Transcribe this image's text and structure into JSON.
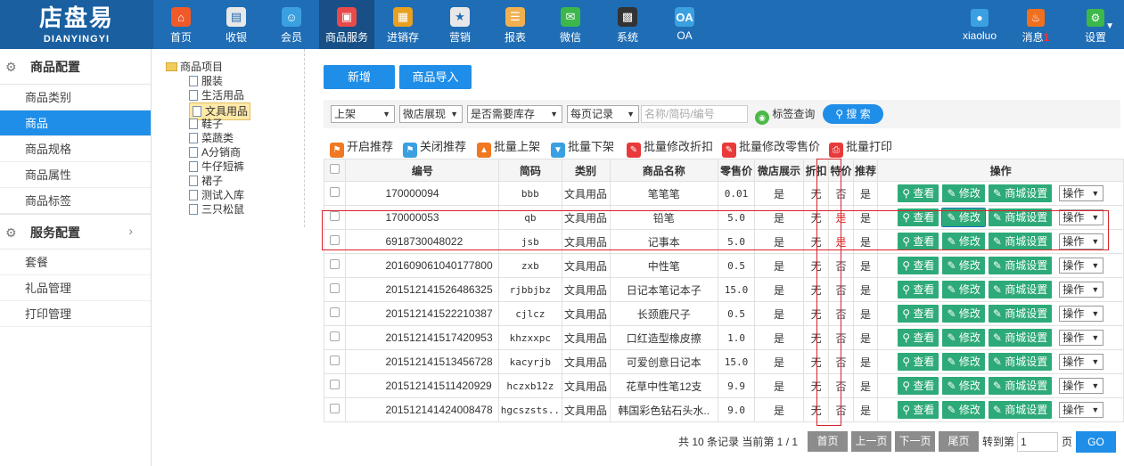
{
  "app": {
    "logo_cn": "店盘易",
    "logo_en": "DIANYINGYI"
  },
  "nav": [
    {
      "label": "首页",
      "icon": "home-icon",
      "color": "#f05a28"
    },
    {
      "label": "收银",
      "icon": "cash-register-icon",
      "color": "#e8e8e8"
    },
    {
      "label": "会员",
      "icon": "member-icon",
      "color": "#3aa0e0"
    },
    {
      "label": "商品服务",
      "icon": "goods-icon",
      "color": "#e84a4a"
    },
    {
      "label": "进销存",
      "icon": "inventory-icon",
      "color": "#e8a020"
    },
    {
      "label": "营销",
      "icon": "megaphone-icon",
      "color": "#e8e8e8"
    },
    {
      "label": "报表",
      "icon": "report-icon",
      "color": "#f0b050"
    },
    {
      "label": "微信",
      "icon": "wechat-icon",
      "color": "#3cb84a"
    },
    {
      "label": "系统",
      "icon": "monitor-icon",
      "color": "#333333"
    },
    {
      "label": "OA",
      "icon": "oa-icon",
      "color": "#3aa0e0"
    }
  ],
  "user": {
    "name": "xiaoluo",
    "messages": "消息",
    "msg_count": "1",
    "settings": "设置"
  },
  "sidebar": {
    "group1": "商品配置",
    "items1": [
      "商品类别",
      "商品",
      "商品规格",
      "商品属性",
      "商品标签"
    ],
    "group2": "服务配置",
    "items2": [
      "套餐",
      "礼品管理",
      "打印管理"
    ]
  },
  "tree": {
    "root": "商品项目",
    "children": [
      "服装",
      "生活用品",
      "文具用品",
      "鞋子",
      "菜蔬类",
      "A分销商",
      "牛仔短裤",
      "裙子",
      "测试入库",
      "三只松鼠"
    ]
  },
  "buttons": {
    "add": "新增",
    "import": "商品导入"
  },
  "filters": {
    "status": "上架",
    "wx_show": "微店展现",
    "stock": "是否需要库存",
    "page_size": "每页记录",
    "keyword_placeholder": "名称/简码/编号",
    "tag_query": "标签查询",
    "search": "搜 索"
  },
  "actions": [
    "开启推荐",
    "关闭推荐",
    "批量上架",
    "批量下架",
    "批量修改折扣",
    "批量修改零售价",
    "批量打印"
  ],
  "table": {
    "headers": [
      "编号",
      "简码",
      "类别",
      "商品名称",
      "零售价",
      "微店展示",
      "折扣",
      "特价",
      "推荐",
      "操作"
    ],
    "rows": [
      {
        "code": "170000094",
        "short": "bbb",
        "cat": "文具用品",
        "name": "笔笔笔",
        "price": "0.01",
        "wx": "是",
        "disc": "无",
        "special": "否",
        "rec": "是"
      },
      {
        "code": "170000053",
        "short": "qb",
        "cat": "文具用品",
        "name": "铅笔",
        "price": "5.0",
        "wx": "是",
        "disc": "无",
        "special": "是",
        "rec": "是"
      },
      {
        "code": "6918730048022",
        "short": "jsb",
        "cat": "文具用品",
        "name": "记事本",
        "price": "5.0",
        "wx": "是",
        "disc": "无",
        "special": "是",
        "rec": "是"
      },
      {
        "code": "201609061040177800",
        "short": "zxb",
        "cat": "文具用品",
        "name": "中性笔",
        "price": "0.5",
        "wx": "是",
        "disc": "无",
        "special": "否",
        "rec": "是"
      },
      {
        "code": "201512141526486325",
        "short": "rjbbjbz",
        "cat": "文具用品",
        "name": "日记本笔记本子",
        "price": "15.0",
        "wx": "是",
        "disc": "无",
        "special": "否",
        "rec": "是"
      },
      {
        "code": "201512141522210387",
        "short": "cjlcz",
        "cat": "文具用品",
        "name": "长颈鹿尺子",
        "price": "0.5",
        "wx": "是",
        "disc": "无",
        "special": "否",
        "rec": "是"
      },
      {
        "code": "201512141517420953",
        "short": "khzxxpc",
        "cat": "文具用品",
        "name": "口红造型橡皮擦",
        "price": "1.0",
        "wx": "是",
        "disc": "无",
        "special": "否",
        "rec": "是"
      },
      {
        "code": "201512141513456728",
        "short": "kacyrjb",
        "cat": "文具用品",
        "name": "可爱创意日记本",
        "price": "15.0",
        "wx": "是",
        "disc": "无",
        "special": "否",
        "rec": "是"
      },
      {
        "code": "201512141511420929",
        "short": "hczxb12z",
        "cat": "文具用品",
        "name": "花草中性笔12支",
        "price": "9.9",
        "wx": "是",
        "disc": "无",
        "special": "否",
        "rec": "是"
      },
      {
        "code": "201512141424008478",
        "short": "hgcszsts..",
        "cat": "文具用品",
        "name": "韩国彩色钻石头水..",
        "price": "9.0",
        "wx": "是",
        "disc": "无",
        "special": "否",
        "rec": "是"
      }
    ],
    "op_view": "查看",
    "op_edit": "修改",
    "op_mall": "商城设置",
    "op_more": "操作"
  },
  "pager": {
    "summary": "共 10 条记录 当前第 1 / 1",
    "first": "首页",
    "prev": "上一页",
    "next": "下一页",
    "last": "尾页",
    "goto": "转到第",
    "page_value": "1",
    "page_unit": "页",
    "go": "GO"
  }
}
